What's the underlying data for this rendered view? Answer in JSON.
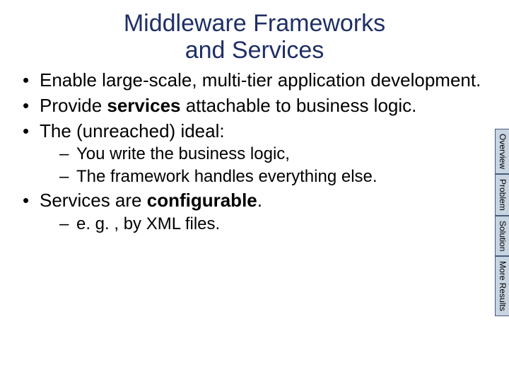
{
  "title_line1": "Middleware Frameworks",
  "title_line2": "and Services",
  "bullets": {
    "b1": "Enable large-scale, multi-tier application development.",
    "b2a": "Provide ",
    "b2b": "services",
    "b2c": " attachable to business logic.",
    "b3": "The (unreached) ideal:",
    "b3_sub1": "You write the business logic,",
    "b3_sub2": "The framework handles everything else.",
    "b4a": "Services are ",
    "b4b": "configurable",
    "b4c": ".",
    "b4_sub1": "e. g. , by XML files."
  },
  "tabs": {
    "t1": "Overview",
    "t2": "Problem",
    "t3": "Solution",
    "t4": "More Results"
  }
}
